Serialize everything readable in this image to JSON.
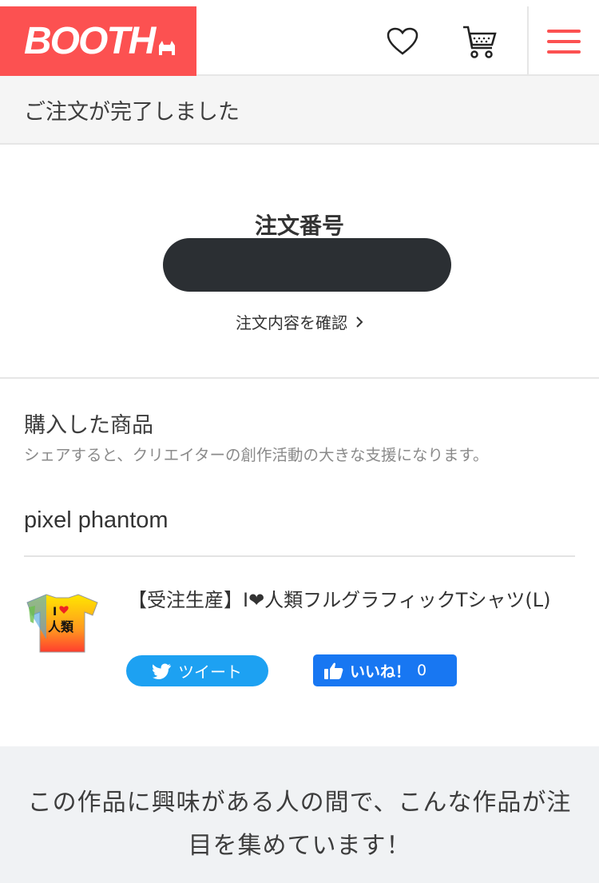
{
  "header": {
    "logo_text": "BOOTH",
    "brand_color": "#fc5151",
    "icons": [
      "heart-icon",
      "cart-icon",
      "menu-icon"
    ]
  },
  "status": {
    "message": "ご注文が完了しました"
  },
  "order": {
    "label": "注文番号",
    "number_redacted": "",
    "details_link": "注文内容を確認"
  },
  "purchased": {
    "title": "購入した商品",
    "subtitle": "シェアすると、クリエイターの創作活動の大きな支援になります。",
    "shop_name": "pixel phantom",
    "item": {
      "title": "【受注生産】I❤人類フルグラフィックTシャツ(L)",
      "thumbnail": "tshirt-thumbnail"
    },
    "tweet_label": "ツイート",
    "like_label": "いいね！",
    "like_count": "0",
    "colors": {
      "twitter": "#1da1f2",
      "facebook": "#1877f2"
    }
  },
  "recommendation": {
    "text": "この作品に興味がある人の間で、こんな作品が注目を集めています！"
  }
}
